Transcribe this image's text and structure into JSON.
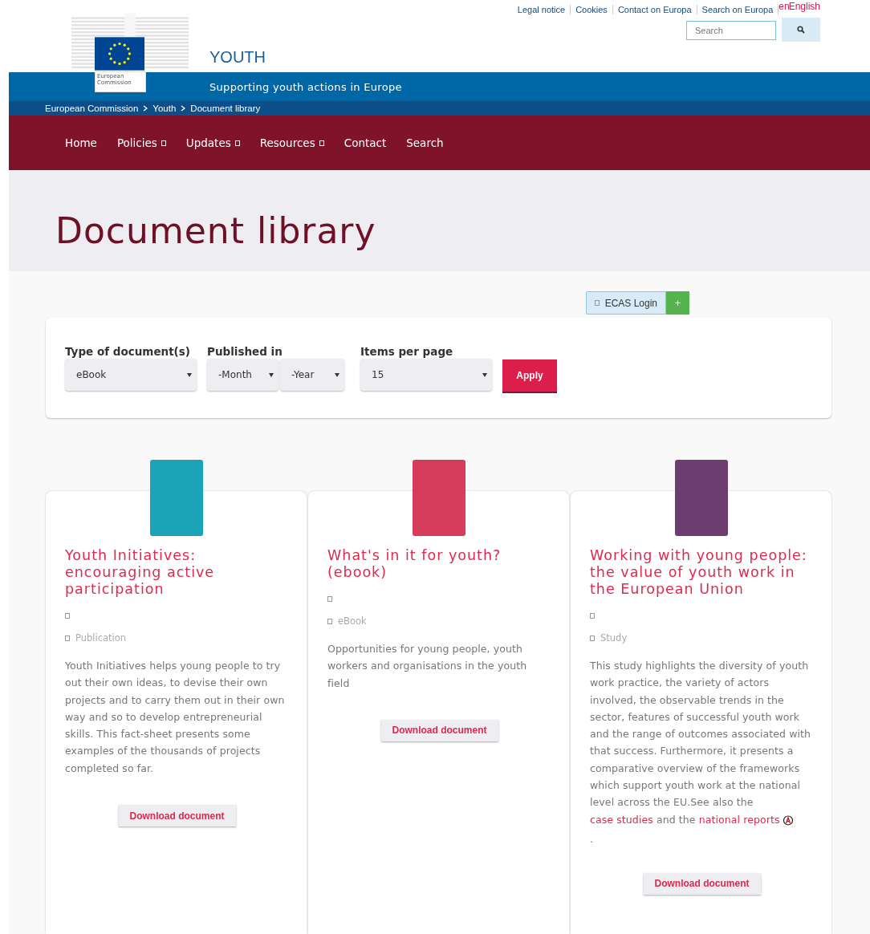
{
  "top_links": [
    "Legal notice",
    "Cookies",
    "Contact on Europa",
    "Search on Europa"
  ],
  "language": {
    "code": "en",
    "label": "English"
  },
  "search": {
    "placeholder": "Search"
  },
  "logo_text": "European Commission",
  "site": {
    "title": "YOUTH",
    "subtitle": "Supporting youth actions in Europe"
  },
  "breadcrumb": [
    "European Commission",
    "Youth",
    "Document library"
  ],
  "nav": [
    {
      "label": "Home",
      "dropdown": false
    },
    {
      "label": "Policies",
      "dropdown": true
    },
    {
      "label": "Updates",
      "dropdown": true
    },
    {
      "label": "Resources",
      "dropdown": true
    },
    {
      "label": "Contact",
      "dropdown": false
    },
    {
      "label": "Search",
      "dropdown": false
    }
  ],
  "page_title": "Document library",
  "login": {
    "label": "ECAS Login",
    "plus": "+"
  },
  "filters": [
    {
      "label": "Type of document(s)",
      "selects": [
        "eBook"
      ]
    },
    {
      "label": "Published in",
      "selects": [
        "-Month",
        "-Year"
      ]
    },
    {
      "label": "Items per page",
      "selects": [
        "15"
      ]
    }
  ],
  "apply": "Apply",
  "documents": [
    {
      "title": "Youth Initiatives: encouraging active participation",
      "type": "Publication",
      "description": [
        {
          "kind": "text",
          "text": "Youth Initiatives helps young people to try out their own ideas, to devise their own projects and to carry them out in their own way and so to develop entrepreneurial skills. This fact-sheet presents some examples of the thousands of projects completed so far."
        }
      ],
      "download": "Download document"
    },
    {
      "title": "What's in it for youth? (ebook)",
      "type": "eBook",
      "description": [
        {
          "kind": "text",
          "text": "Opportunities for young people, youth workers and organisations in the youth field"
        }
      ],
      "download": "Download document"
    },
    {
      "title": "Working with young people: the value of youth work in the European Union",
      "type": "Study",
      "description": [
        {
          "kind": "text",
          "text": "This study highlights the diversity of youth work practice, the variety of actors involved, the observable trends in the sector, features of successful youth work and the range of outcomes associated with that success. Furthermore, it presents a comparative overview of the frameworks which support youth work at the national level across the EU.See also the "
        },
        {
          "kind": "link",
          "text": "case studies"
        },
        {
          "kind": "text",
          "text": " and the "
        },
        {
          "kind": "link",
          "text": "national reports"
        },
        {
          "kind": "pdf"
        },
        {
          "kind": "text",
          "text": "."
        }
      ],
      "download": "Download document"
    }
  ]
}
